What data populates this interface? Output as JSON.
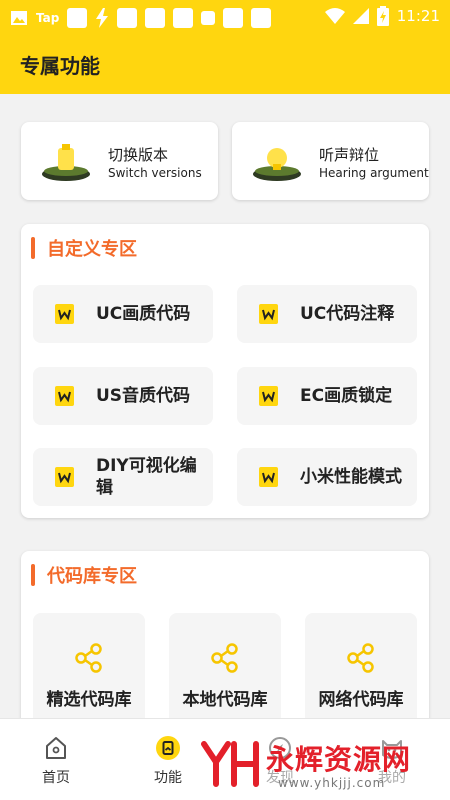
{
  "status_bar": {
    "carrier": "Tap",
    "time": "11:21"
  },
  "header": {
    "title": "专属功能"
  },
  "top_cards": [
    {
      "title": "切换版本",
      "subtitle": "Switch versions"
    },
    {
      "title": "听声辩位",
      "subtitle": "Hearing argument"
    }
  ],
  "custom_zone": {
    "title": "自定义专区",
    "items": [
      {
        "label": "UC画质代码"
      },
      {
        "label": "UC代码注释"
      },
      {
        "label": "US音质代码"
      },
      {
        "label": "EC画质锁定"
      },
      {
        "label": "DIY可视化编辑"
      },
      {
        "label": "小米性能模式"
      }
    ]
  },
  "library_zone": {
    "title": "代码库专区",
    "items": [
      {
        "label": "精选代码库"
      },
      {
        "label": "本地代码库"
      },
      {
        "label": "网络代码库"
      }
    ]
  },
  "bottom_nav": {
    "items": [
      {
        "label": "首页"
      },
      {
        "label": "功能"
      },
      {
        "label": "发现"
      },
      {
        "label": "我的"
      }
    ]
  },
  "watermark": {
    "text": "永辉资源网",
    "url": "www.yhkjjj.com"
  },
  "colors": {
    "brand_yellow": "#ffd60f",
    "accent_orange": "#f36b2b",
    "watermark_red": "#e3202a"
  }
}
